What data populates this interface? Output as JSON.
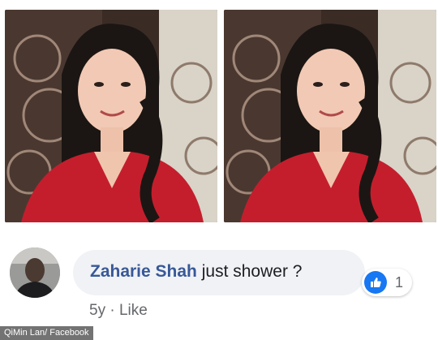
{
  "photos": [
    {
      "alt_name": "photo-left"
    },
    {
      "alt_name": "photo-right"
    }
  ],
  "comment": {
    "author": "Zaharie Shah",
    "text": "just shower ?",
    "reaction_count": "1",
    "timestamp": "5y",
    "separator": "·",
    "like_label": "Like"
  },
  "credit": "QiMin Lan/ Facebook",
  "colors": {
    "author_link": "#385898",
    "like_blue": "#1877f2",
    "bubble_bg": "#f0f2f5",
    "meta_gray": "#65676b"
  },
  "icons": [
    "like-thumb-icon",
    "avatar"
  ]
}
